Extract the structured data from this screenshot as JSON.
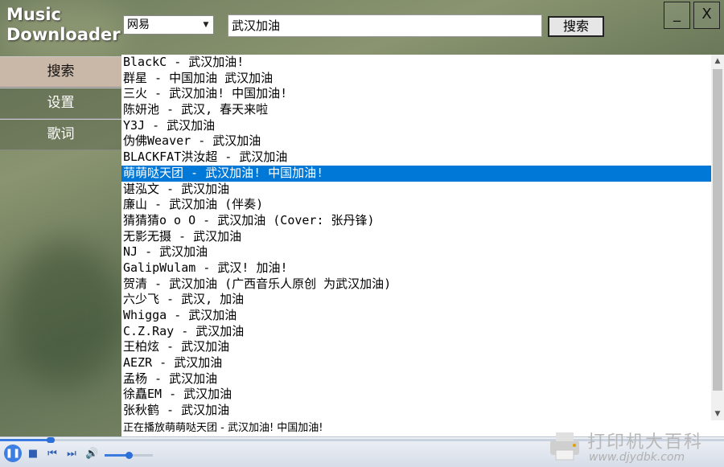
{
  "app": {
    "logo_line1": "Music",
    "logo_line2": "Downloader"
  },
  "window": {
    "minimize_label": "_",
    "close_label": "X"
  },
  "search": {
    "source_selected": "网易",
    "query_value": "武汉加油",
    "button_label": "搜索"
  },
  "sidebar": {
    "items": [
      {
        "label": "搜索",
        "active": true
      },
      {
        "label": "设置",
        "active": false
      },
      {
        "label": "歌词",
        "active": false
      }
    ]
  },
  "results": {
    "selected_index": 7,
    "rows": [
      "BlackC - 武汉加油!",
      "群星 - 中国加油 武汉加油",
      "三火 - 武汉加油! 中国加油!",
      "陈妍池 - 武汉, 春天来啦",
      "Y3J - 武汉加油",
      "伪佛Weaver - 武汉加油",
      "BLACKFAT洪汝超 - 武汉加油",
      "萌萌哒天团 - 武汉加油! 中国加油!",
      "谌泓文 - 武汉加油",
      "廉山 - 武汉加油 (伴奏)",
      "猜猜猜o o O - 武汉加油 (Cover: 张丹锋)",
      "无影无摄 - 武汉加油",
      "NJ - 武汉加油",
      "GalipWulam - 武汉! 加油!",
      "贺清 - 武汉加油 (广西音乐人原创 为武汉加油)",
      "六少飞 - 武汉, 加油",
      "Whigga - 武汉加油",
      "C.Z.Ray - 武汉加油",
      "王柏炫 - 武汉加油",
      "AEZR - 武汉加油",
      "孟杨 - 武汉加油",
      "徐矗EM - 武汉加油",
      "张秋鹤 - 武汉加油"
    ]
  },
  "status": {
    "text": "正在播放萌萌哒天团 - 武汉加油! 中国加油!"
  },
  "player": {
    "progress": 0.07,
    "volume": 0.5,
    "icons": [
      "pause-icon",
      "stop-icon",
      "previous-icon",
      "next-icon",
      "volume-icon"
    ]
  },
  "watermark": {
    "text_cn": "打印机大百科",
    "text_url": "www.djydbk.com"
  },
  "colors": {
    "selection": "#0078d7",
    "accent": "#3b7be0"
  }
}
